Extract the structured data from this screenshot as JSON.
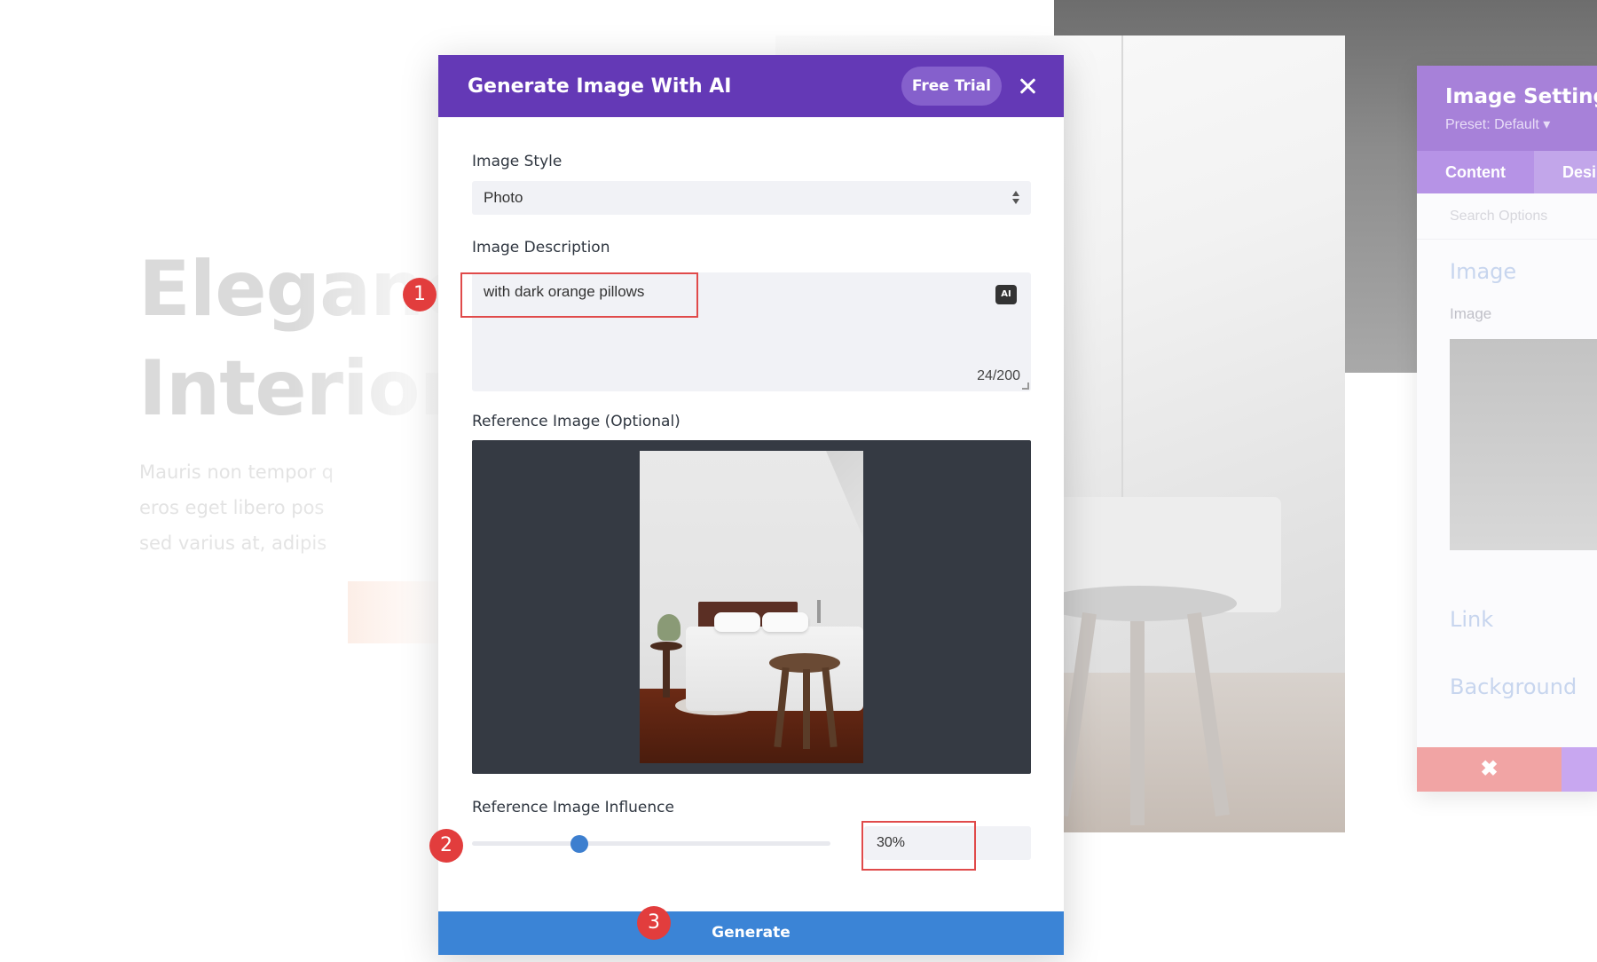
{
  "background": {
    "heading_line1": "Eleganc",
    "heading_line2": "Interior D",
    "paragraph": [
      "Mauris non tempor q",
      "eros eget libero pos",
      "sed varius at, adipis"
    ]
  },
  "settings_panel": {
    "title": "Image Settings",
    "preset": "Preset: Default ▾",
    "tabs": [
      {
        "label": "Content",
        "active": true
      },
      {
        "label": "Desi",
        "active": false
      }
    ],
    "search_placeholder": "Search Options",
    "sections": [
      "Image",
      "Link",
      "Background"
    ],
    "image_field_label": "Image",
    "cancel_icon": "✖"
  },
  "modal": {
    "title": "Generate Image With AI",
    "free_trial_label": "Free Trial",
    "close_icon": "close-icon",
    "image_style": {
      "label": "Image Style",
      "value": "Photo"
    },
    "image_description": {
      "label": "Image Description",
      "value": "with dark orange pillows",
      "ai_badge": "AI",
      "char_count": "24/200"
    },
    "reference_image": {
      "label": "Reference Image (Optional)"
    },
    "influence": {
      "label": "Reference Image Influence",
      "value_percent": 30,
      "display": "30%"
    },
    "generate_label": "Generate"
  },
  "annotations": {
    "step1": "1",
    "step2": "2",
    "step3": "3"
  },
  "colors": {
    "modal_header": "#6439b6",
    "free_trial_bg": "#8560cc",
    "generate_button": "#3b84d6",
    "slider_thumb": "#3d7fcf",
    "annotation_red": "#e23d3d",
    "settings_header": "#a781d9"
  }
}
